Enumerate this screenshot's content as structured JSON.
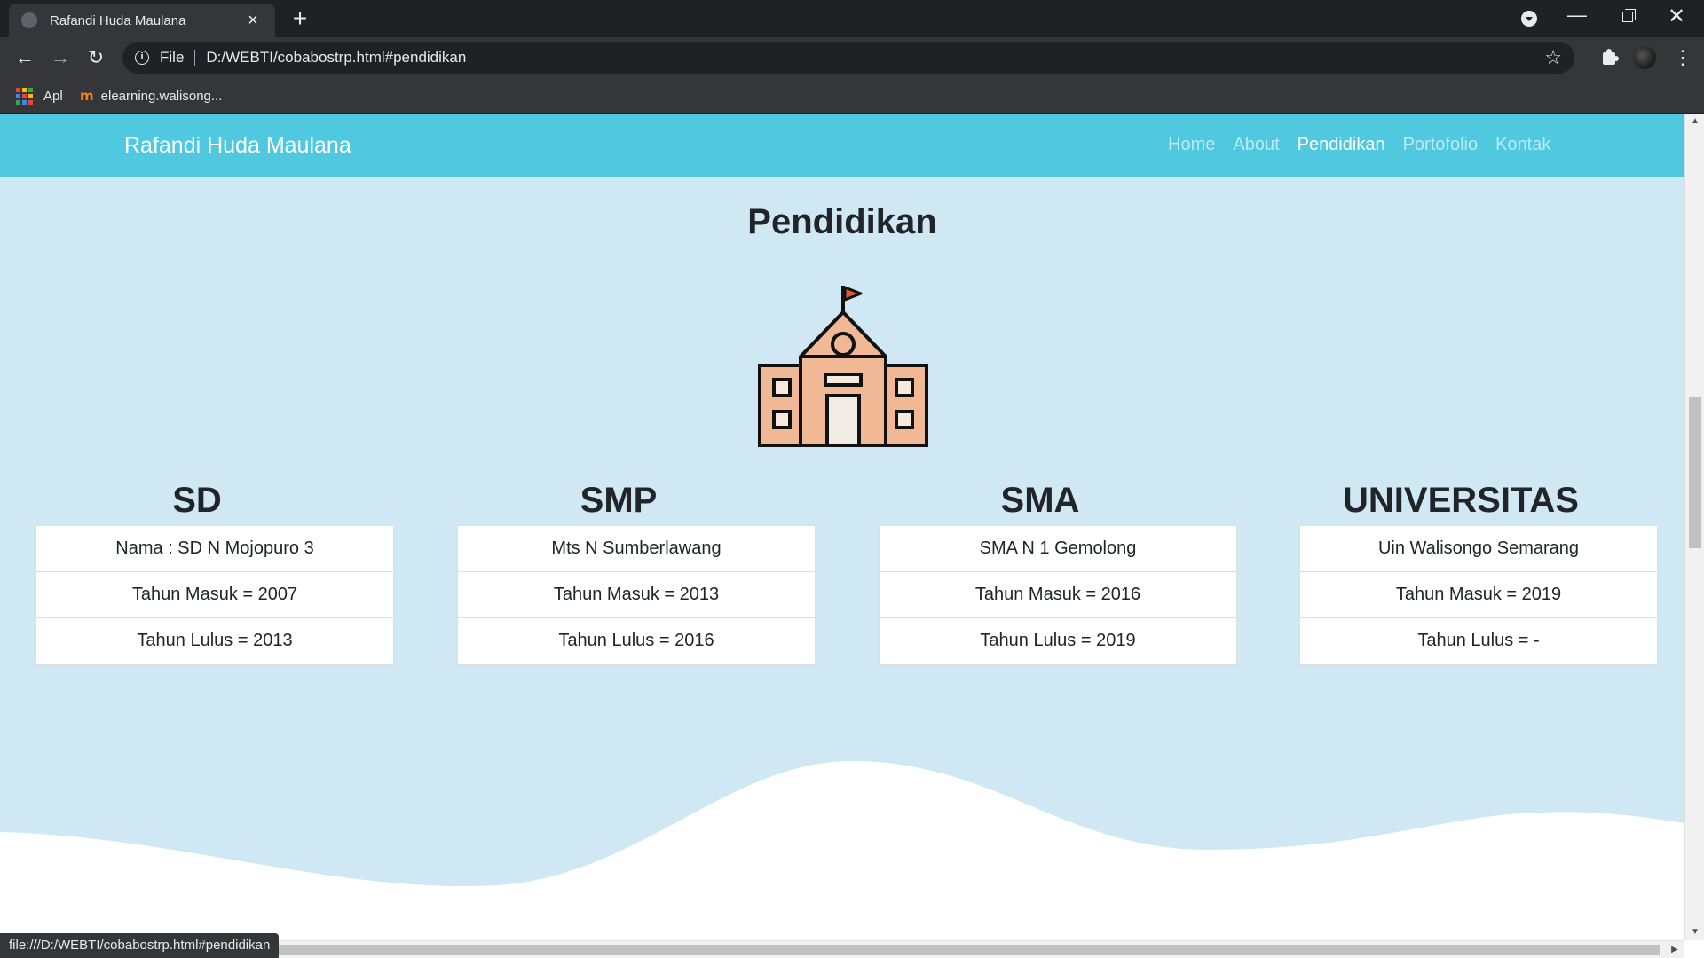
{
  "browser": {
    "tab_title": "Rafandi Huda Maulana",
    "scheme_label": "File",
    "url": "D:/WEBTI/cobabostrp.html#pendidikan",
    "bookmarks": [
      {
        "label": "Apl",
        "icon": "apps-grid-icon"
      },
      {
        "label": "elearning.walisong...",
        "icon": "moodle-icon"
      }
    ],
    "status_url": "file:///D:/WEBTI/cobabostrp.html#pendidikan"
  },
  "navbar": {
    "brand": "Rafandi Huda Maulana",
    "links": [
      {
        "label": "Home",
        "active": false
      },
      {
        "label": "About",
        "active": false
      },
      {
        "label": "Pendidikan",
        "active": true
      },
      {
        "label": "Portofolio",
        "active": false
      },
      {
        "label": "Kontak",
        "active": false
      }
    ],
    "color": "#4fc8e0"
  },
  "section": {
    "title": "Pendidikan",
    "icon": "school-building-icon",
    "background": "#d0e8f4"
  },
  "education": [
    {
      "level": "SD",
      "rows": [
        "Nama : SD N Mojopuro 3",
        "Tahun Masuk = 2007",
        "Tahun Lulus = 2013"
      ]
    },
    {
      "level": "SMP",
      "rows": [
        "Mts N Sumberlawang",
        "Tahun Masuk = 2013",
        "Tahun Lulus = 2016"
      ]
    },
    {
      "level": "SMA",
      "rows": [
        "SMA N 1 Gemolong",
        "Tahun Masuk = 2016",
        "Tahun Lulus = 2019"
      ]
    },
    {
      "level": "UNIVERSITAS",
      "rows": [
        "Uin Walisongo Semarang",
        "Tahun Masuk = 2019",
        "Tahun Lulus = -"
      ]
    }
  ]
}
